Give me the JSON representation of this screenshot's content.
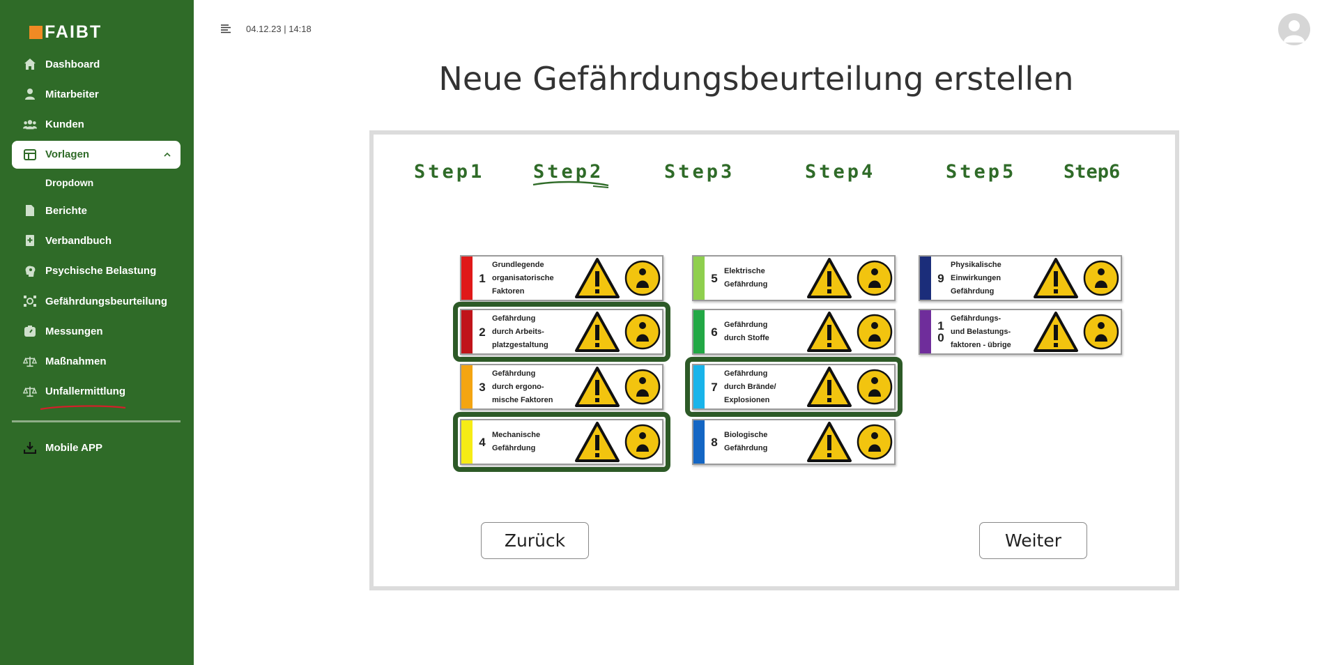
{
  "app": {
    "logo": "FAIBT",
    "brand_color": "#2f6b28",
    "accent_color": "#f08a24"
  },
  "sidebar": {
    "items": [
      {
        "label": "Dashboard",
        "icon": "home-icon"
      },
      {
        "label": "Mitarbeiter",
        "icon": "person-icon"
      },
      {
        "label": "Kunden",
        "icon": "group-icon"
      },
      {
        "label": "Vorlagen",
        "icon": "table-icon",
        "active": true
      },
      {
        "label": "Berichte",
        "icon": "document-icon"
      },
      {
        "label": "Verbandbuch",
        "icon": "medical-book-icon"
      },
      {
        "label": "Psychische Belastung",
        "icon": "brain-icon"
      },
      {
        "label": "Gefährdungsbeurteilung",
        "icon": "hazard-assessment-icon"
      },
      {
        "label": "Messungen",
        "icon": "gauge-icon"
      },
      {
        "label": "Maßnahmen",
        "icon": "scale-icon"
      },
      {
        "label": "Unfallermittlung",
        "icon": "scale-icon"
      }
    ],
    "sub_item": "Dropdown",
    "bottom_item": {
      "label": "Mobile APP",
      "icon": "download-icon"
    }
  },
  "header": {
    "datetime": "04.12.23 | 14:18"
  },
  "main": {
    "title": "Neue Gefährdungsbeurteilung erstellen",
    "steps": [
      "Step1",
      "Step2",
      "Step3",
      "Step4",
      "Step5",
      "Step6"
    ],
    "active_step": "Step2",
    "hazards": [
      {
        "num": "1",
        "lines": [
          "Grundlegende",
          "organisatorische",
          "Faktoren"
        ],
        "color": "#e01919",
        "selected": false
      },
      {
        "num": "2",
        "lines": [
          "Gefährdung",
          "durch Arbeits-",
          "platzgestaltung"
        ],
        "color": "#c0141a",
        "selected": true
      },
      {
        "num": "3",
        "lines": [
          "Gefährdung",
          "durch ergono-",
          "mische Faktoren"
        ],
        "color": "#f4a512",
        "selected": false
      },
      {
        "num": "4",
        "lines": [
          "Mechanische",
          "Gefährdung"
        ],
        "color": "#f6ec16",
        "selected": true
      },
      {
        "num": "5",
        "lines": [
          "Elektrische",
          "Gefährdung"
        ],
        "color": "#8fcf4e",
        "selected": false
      },
      {
        "num": "6",
        "lines": [
          "Gefährdung",
          "durch Stoffe"
        ],
        "color": "#22a845",
        "selected": false
      },
      {
        "num": "7",
        "lines": [
          "Gefährdung",
          "durch Brände/",
          "Explosionen"
        ],
        "color": "#19b4ea",
        "selected": true
      },
      {
        "num": "8",
        "lines": [
          "Biologische",
          "Gefährdung"
        ],
        "color": "#1466c4",
        "selected": false
      },
      {
        "num": "9",
        "lines": [
          "Physikalische",
          "Einwirkungen",
          "Gefährdung"
        ],
        "color": "#1b2d7a",
        "selected": false
      },
      {
        "num": "1\n0",
        "lines": [
          "Gefährdungs-",
          "und Belastungs-",
          "faktoren - übrige"
        ],
        "color": "#6f2d9b",
        "selected": false
      }
    ],
    "back_label": "Zurück",
    "next_label": "Weiter"
  }
}
